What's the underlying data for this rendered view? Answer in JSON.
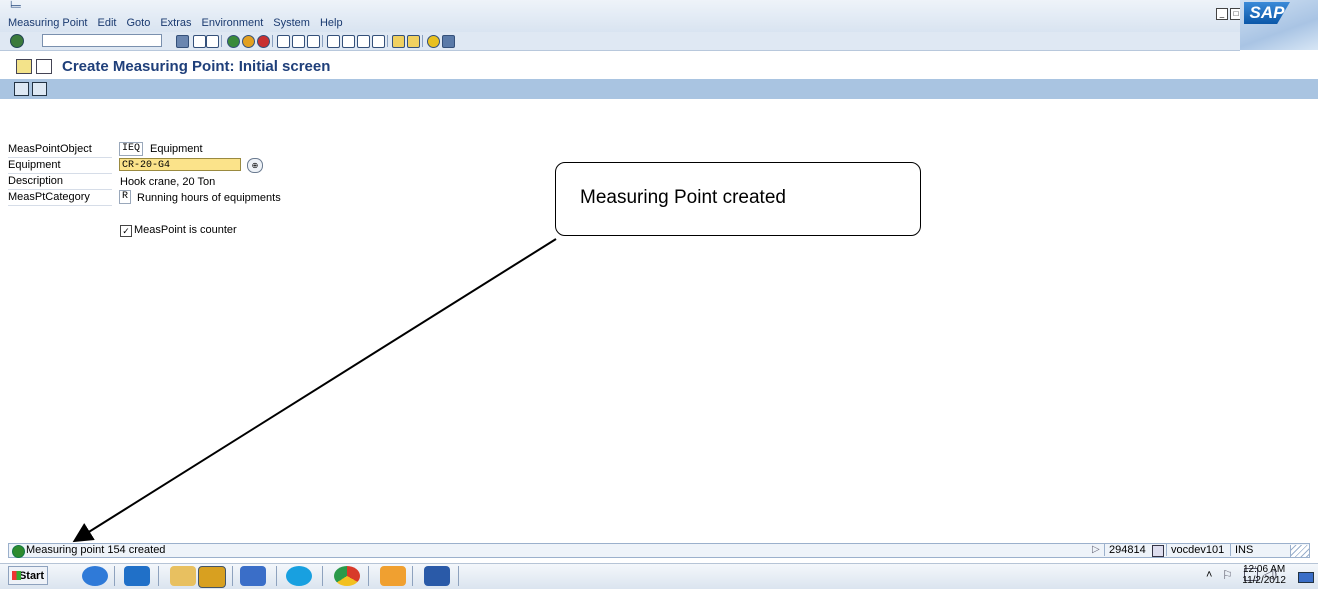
{
  "menu": [
    "Measuring Point",
    "Edit",
    "Goto",
    "Extras",
    "Environment",
    "System",
    "Help"
  ],
  "brand": "SAP",
  "title": "Create Measuring Point: Initial screen",
  "form": {
    "measpointobject_label": "MeasPointObject",
    "measpointobject_code": "IEQ",
    "measpointobject_value": "Equipment",
    "equipment_label": "Equipment",
    "equipment_value": "CR-20-G4",
    "description_label": "Description",
    "description_value": "Hook crane, 20 Ton",
    "category_label": "MeasPtCategory",
    "category_code": "R",
    "category_value": "Running hours of equipments",
    "counter_label": "MeasPoint is counter",
    "counter_checked": true
  },
  "callout": {
    "text": "Measuring Point created"
  },
  "status": {
    "message": "Measuring point 154 created",
    "session": "294814",
    "server": "vocdev101",
    "mode": "INS"
  },
  "taskbar": {
    "start_label": "Start",
    "time": "12:06 AM",
    "date": "11/2/2012"
  },
  "colors": {
    "title": "#1f3f7a",
    "app_toolbar": "#a9c4e1",
    "required_field": "#fbe38a",
    "status_ok": "#2e8b2e"
  }
}
